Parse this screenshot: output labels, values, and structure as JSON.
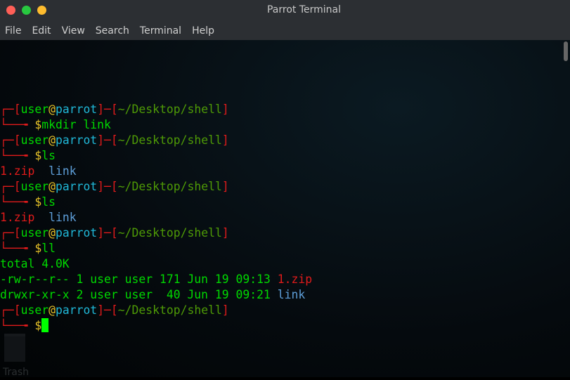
{
  "window": {
    "title": "Parrot Terminal",
    "buttons": {
      "close": "#ff5f57",
      "maximize": "#28c840",
      "minimize": "#febc2e"
    }
  },
  "menu": [
    "File",
    "Edit",
    "View",
    "Search",
    "Terminal",
    "Help"
  ],
  "prompt": {
    "top": "┌─[",
    "user": "user",
    "at": "@",
    "host": "parrot",
    "sep": "]─[",
    "path": "~/Desktop/shell",
    "end": "]",
    "bottom": "└──╼ ",
    "dollar": "$"
  },
  "lines": [
    {
      "type": "prompt"
    },
    {
      "type": "cmd",
      "text": "mkdir link"
    },
    {
      "type": "prompt"
    },
    {
      "type": "cmd",
      "text": "ls"
    },
    {
      "type": "ls",
      "items": [
        {
          "text": "1.zip",
          "kind": "archive"
        },
        {
          "text": "link",
          "kind": "dir"
        }
      ]
    },
    {
      "type": "prompt"
    },
    {
      "type": "cmd",
      "text": "ls"
    },
    {
      "type": "ls",
      "items": [
        {
          "text": "1.zip",
          "kind": "archive"
        },
        {
          "text": "link",
          "kind": "dir"
        }
      ]
    },
    {
      "type": "prompt"
    },
    {
      "type": "cmd",
      "text": "ll"
    },
    {
      "type": "out",
      "text": "total 4.0K"
    },
    {
      "type": "ll",
      "text": "-rw-r--r-- 1 user user 171 Jun 19 09:13 ",
      "name": "1.zip",
      "kind": "archive"
    },
    {
      "type": "ll",
      "text": "drwxr-xr-x 2 user user  40 Jun 19 09:21 ",
      "name": "link",
      "kind": "dir"
    },
    {
      "type": "prompt"
    },
    {
      "type": "cmd",
      "text": "",
      "cursor": true
    }
  ],
  "desktop": {
    "trash_label": "Trash"
  },
  "colors": {
    "bracket": "#e01b1b",
    "user": "#00d900",
    "at": "#e6c229",
    "host": "#20b8d8",
    "path": "#4e9a06",
    "archive": "#e01b1b",
    "dir": "#5e9fd9",
    "cursor": "#00ff00"
  }
}
